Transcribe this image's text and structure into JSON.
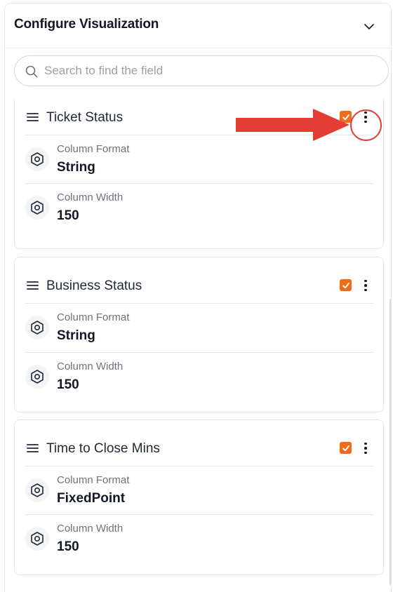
{
  "panel": {
    "title": "Configure Visualization",
    "collapse_icon": "chevron-down-icon"
  },
  "search": {
    "placeholder": "Search to find the field",
    "value": ""
  },
  "fields": [
    {
      "name": "Ticket Status",
      "checked": true,
      "properties": [
        {
          "label": "Column Format",
          "value": "String",
          "icon": "hexagon-nut-icon"
        },
        {
          "label": "Column Width",
          "value": "150",
          "icon": "hexagon-nut-icon"
        }
      ]
    },
    {
      "name": "Business Status",
      "checked": true,
      "properties": [
        {
          "label": "Column Format",
          "value": "String",
          "icon": "hexagon-nut-icon"
        },
        {
          "label": "Column Width",
          "value": "150",
          "icon": "hexagon-nut-icon"
        }
      ]
    },
    {
      "name": "Time to Close Mins",
      "checked": true,
      "properties": [
        {
          "label": "Column Format",
          "value": "FixedPoint",
          "icon": "hexagon-nut-icon"
        },
        {
          "label": "Column Width",
          "value": "150",
          "icon": "hexagon-nut-icon"
        }
      ]
    }
  ],
  "colors": {
    "accent": "#f26b16",
    "annotation": "#e43d36"
  }
}
